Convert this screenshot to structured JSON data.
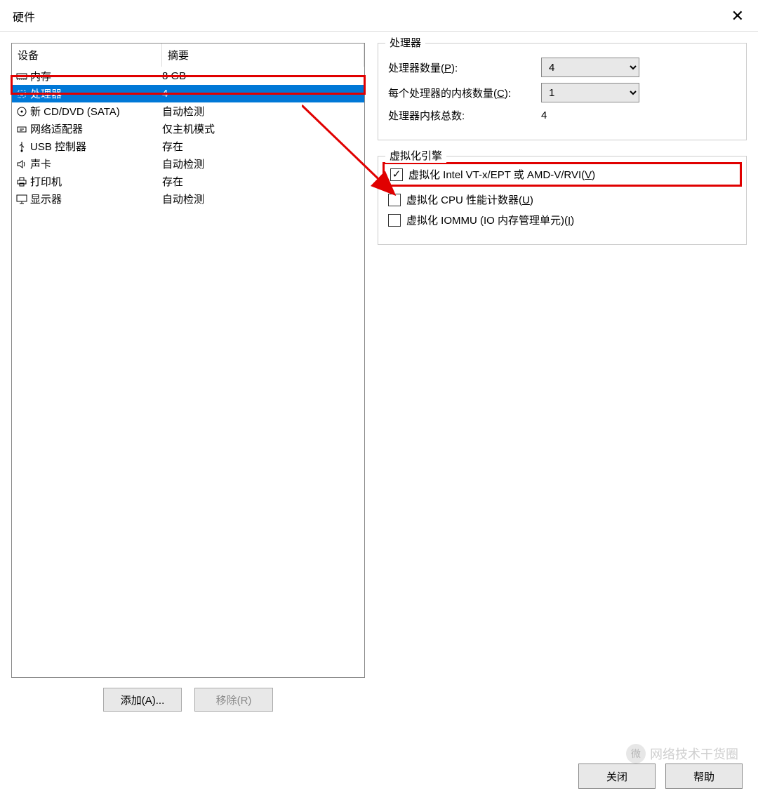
{
  "window": {
    "title": "硬件"
  },
  "list": {
    "header_device": "设备",
    "header_summary": "摘要",
    "items": [
      {
        "icon": "memory",
        "name": "内存",
        "summary": "8 GB",
        "selected": false
      },
      {
        "icon": "cpu",
        "name": "处理器",
        "summary": "4",
        "selected": true
      },
      {
        "icon": "disc",
        "name": "新 CD/DVD (SATA)",
        "summary": "自动检测",
        "selected": false
      },
      {
        "icon": "network",
        "name": "网络适配器",
        "summary": "仅主机模式",
        "selected": false
      },
      {
        "icon": "usb",
        "name": "USB 控制器",
        "summary": "存在",
        "selected": false
      },
      {
        "icon": "sound",
        "name": "声卡",
        "summary": "自动检测",
        "selected": false
      },
      {
        "icon": "printer",
        "name": "打印机",
        "summary": "存在",
        "selected": false
      },
      {
        "icon": "display",
        "name": "显示器",
        "summary": "自动检测",
        "selected": false
      }
    ]
  },
  "buttons": {
    "add": "添加(A)...",
    "remove": "移除(R)"
  },
  "processor_group": {
    "legend": "处理器",
    "proc_count_label_prefix": "处理器数量(",
    "proc_count_label_key": "P",
    "proc_count_label_suffix": "):",
    "proc_count_value": "4",
    "cores_label_prefix": "每个处理器的内核数量(",
    "cores_label_key": "C",
    "cores_label_suffix": "):",
    "cores_value": "1",
    "total_label": "处理器内核总数:",
    "total_value": "4"
  },
  "virt_group": {
    "legend": "虚拟化引擎",
    "vt_prefix": "虚拟化 Intel VT-x/EPT 或 AMD-V/RVI(",
    "vt_key": "V",
    "vt_suffix": ")",
    "vt_checked": true,
    "cpu_prefix": "虚拟化 CPU 性能计数器(",
    "cpu_key": "U",
    "cpu_suffix": ")",
    "cpu_checked": false,
    "iommu_prefix": "虚拟化 IOMMU (IO 内存管理单元)(",
    "iommu_key": "I",
    "iommu_suffix": ")",
    "iommu_checked": false
  },
  "dialog_buttons": {
    "close": "关闭",
    "help": "帮助"
  },
  "watermark": "网络技术干货圈"
}
